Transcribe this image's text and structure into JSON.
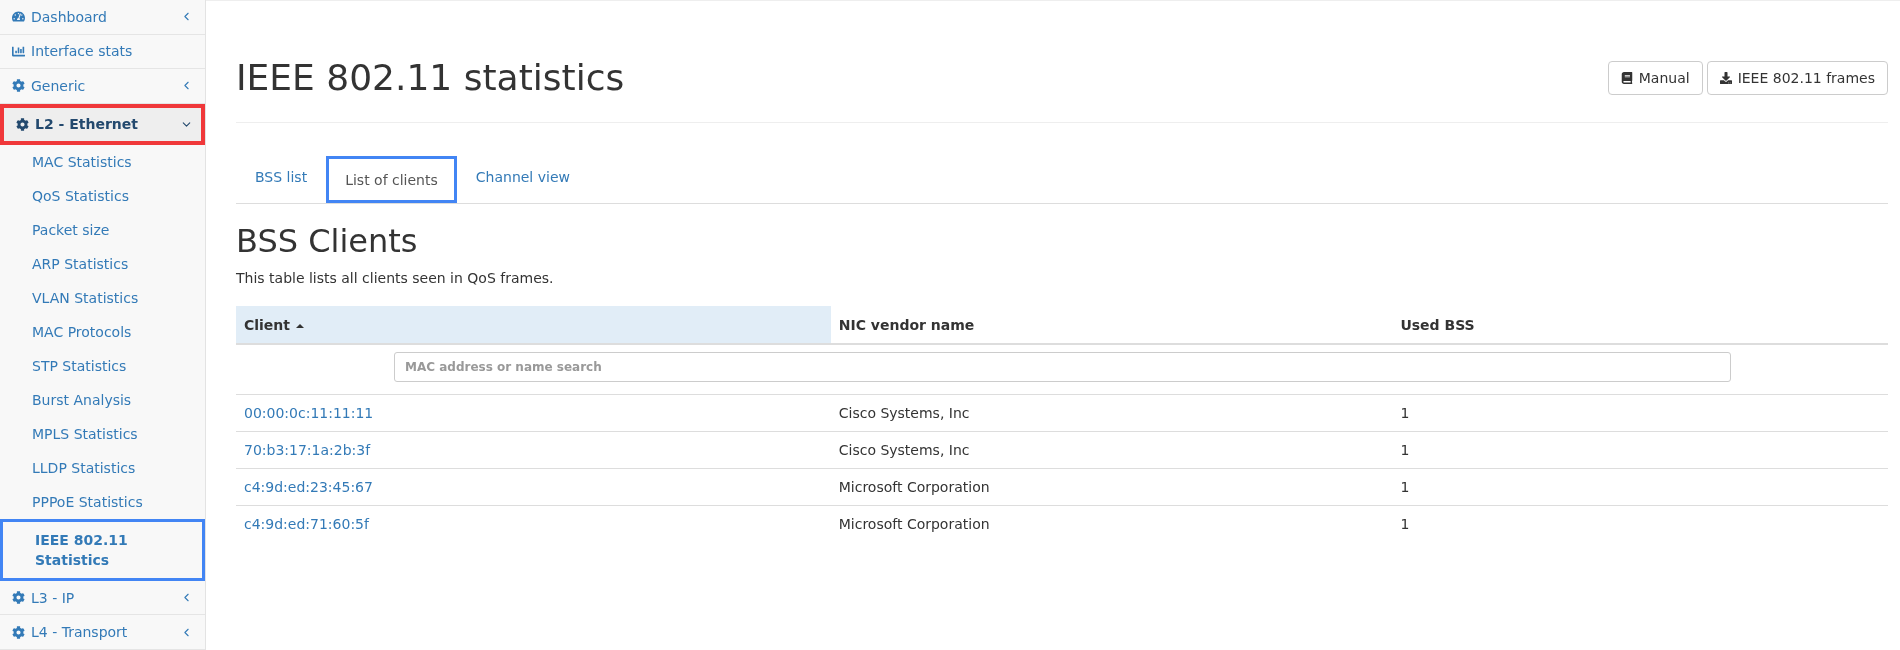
{
  "sidebar": {
    "items": [
      {
        "label": "Dashboard",
        "kind": "group",
        "expanded": false,
        "highlighted": false
      },
      {
        "label": "Interface stats",
        "kind": "link",
        "expanded": false,
        "highlighted": false
      },
      {
        "label": "Generic",
        "kind": "group",
        "expanded": false,
        "highlighted": false
      },
      {
        "label": "L2 - Ethernet",
        "kind": "group",
        "expanded": true,
        "highlighted": true,
        "children": [
          {
            "label": "MAC Statistics",
            "selected": false
          },
          {
            "label": "QoS Statistics",
            "selected": false
          },
          {
            "label": "Packet size",
            "selected": false
          },
          {
            "label": "ARP Statistics",
            "selected": false
          },
          {
            "label": "VLAN Statistics",
            "selected": false
          },
          {
            "label": "MAC Protocols",
            "selected": false
          },
          {
            "label": "STP Statistics",
            "selected": false
          },
          {
            "label": "Burst Analysis",
            "selected": false
          },
          {
            "label": "MPLS Statistics",
            "selected": false
          },
          {
            "label": "LLDP Statistics",
            "selected": false
          },
          {
            "label": "PPPoE Statistics",
            "selected": false
          },
          {
            "label": "IEEE 802.11 Statistics",
            "selected": true
          }
        ]
      },
      {
        "label": "L3 - IP",
        "kind": "group",
        "expanded": false,
        "highlighted": false
      },
      {
        "label": "L4 - Transport",
        "kind": "group",
        "expanded": false,
        "highlighted": false
      }
    ]
  },
  "page": {
    "title": "IEEE 802.11 statistics",
    "buttons": [
      {
        "label": "Manual"
      },
      {
        "label": "IEEE 802.11 frames"
      }
    ]
  },
  "tabs": [
    {
      "label": "BSS list",
      "selected": false
    },
    {
      "label": "List of clients",
      "selected": true
    },
    {
      "label": "Channel view",
      "selected": false
    }
  ],
  "section": {
    "title": "BSS Clients",
    "description": "This table lists all clients seen in QoS frames."
  },
  "table": {
    "columns": [
      {
        "label": "Client",
        "sorted": true
      },
      {
        "label": "NIC vendor name",
        "sorted": false
      },
      {
        "label": "Used BSS",
        "sorted": false
      }
    ],
    "search": {
      "placeholder": "MAC address or name search"
    },
    "rows": [
      [
        "00:00:0c:11:11:11",
        "Cisco Systems, Inc",
        "1"
      ],
      [
        "70:b3:17:1a:2b:3f",
        "Cisco Systems, Inc",
        "1"
      ],
      [
        "c4:9d:ed:23:45:67",
        "Microsoft Corporation",
        "1"
      ],
      [
        "c4:9d:ed:71:60:5f",
        "Microsoft Corporation",
        "1"
      ]
    ]
  }
}
